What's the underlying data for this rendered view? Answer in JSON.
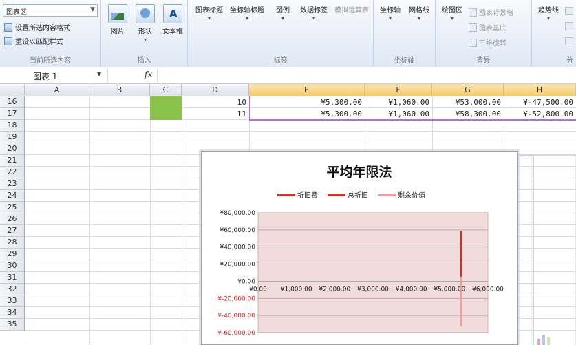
{
  "ribbon": {
    "element_selector": "图表区",
    "format_selection": "设置所选内容格式",
    "reset_style": "重设以匹配样式",
    "current_selection_label": "当前所选内容",
    "insert_group_label": "插入",
    "labels_group_label": "标签",
    "axes_group_label": "坐标轴",
    "background_group_label": "背景",
    "buttons": {
      "picture": "图片",
      "shape": "形状",
      "textbox": "文本框",
      "chart_title": "图表标题",
      "axis_title": "坐标轴标题",
      "legend": "图例",
      "data_labels": "数据标签",
      "data_table": "模拟运算表",
      "axes": "坐标轴",
      "gridlines": "网格线",
      "plot_area": "绘图区",
      "trendline": "趋势线"
    },
    "chart_wall": "图表背景墙",
    "chart_floor": "图表基底",
    "rotation_3d": "三维旋转",
    "analysis_cut": "分"
  },
  "formula_bar": {
    "name_box": "图表 1",
    "fx": "fx"
  },
  "grid": {
    "columns": [
      "A",
      "B",
      "C",
      "D",
      "E",
      "F",
      "G",
      "H"
    ],
    "rows": [
      "16",
      "17",
      "18",
      "19",
      "20",
      "21",
      "22",
      "23",
      "24",
      "25",
      "26",
      "27",
      "28",
      "29",
      "30",
      "31",
      "32",
      "33",
      "34",
      "35"
    ],
    "data_rows": [
      {
        "d": "10",
        "e": "¥5,300.00",
        "f": "¥1,060.00",
        "g": "¥53,000.00",
        "h": "¥-47,500.00"
      },
      {
        "d": "11",
        "e": "¥5,300.00",
        "f": "¥1,060.00",
        "g": "¥58,300.00",
        "h": "¥-52,800.00"
      }
    ],
    "highlight_color": "#8bc34a"
  },
  "chart_data": {
    "type": "line",
    "title": "平均年限法",
    "series": [
      {
        "name": "折旧费",
        "color": "#c0392b"
      },
      {
        "name": "总折旧",
        "color": "#c0392b"
      },
      {
        "name": "剩余价值",
        "color": "#e8a0a0"
      }
    ],
    "xticks": [
      "¥0.00",
      "¥1,000.00",
      "¥2,000.00",
      "¥3,000.00",
      "¥4,000.00",
      "¥5,000.00",
      "¥6,000.00"
    ],
    "xlim": [
      0,
      6000
    ],
    "yticks": [
      "¥80,000.00",
      "¥60,000.00",
      "¥40,000.00",
      "¥20,000.00",
      "¥0.00",
      "¥-20,000.00",
      "¥-40,000.00",
      "¥-60,000.00"
    ],
    "ylim": [
      -60000,
      80000
    ],
    "negative_tick_color": "#d02020",
    "plot_background": "#f2dcdb",
    "grid": true,
    "marks": [
      {
        "series": 1,
        "x": 5300,
        "y_from": 5300,
        "y_to": 58300
      },
      {
        "series": 2,
        "x": 5300,
        "y_from": 5300,
        "y_to": -52800
      }
    ]
  }
}
